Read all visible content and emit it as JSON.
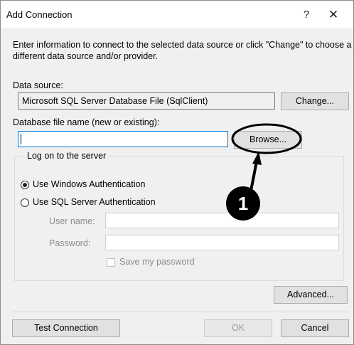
{
  "window": {
    "title": "Add Connection",
    "help_label": "?",
    "close_label": "✕"
  },
  "intro_text": "Enter information to connect to the selected data source or click \"Change\" to choose a different data source and/or provider.",
  "data_source": {
    "label": "Data source:",
    "value": "Microsoft SQL Server Database File (SqlClient)",
    "change_button": "Change..."
  },
  "database_file": {
    "label": "Database file name (new or existing):",
    "value": "",
    "browse_button": "Browse..."
  },
  "logon": {
    "group_label": "Log on to the server",
    "options": [
      {
        "label": "Use Windows Authentication",
        "selected": true
      },
      {
        "label": "Use SQL Server Authentication",
        "selected": false
      }
    ],
    "user_name_label": "User name:",
    "user_name_value": "",
    "password_label": "Password:",
    "password_value": "",
    "save_password_label": "Save my password",
    "save_password_checked": false
  },
  "buttons": {
    "advanced": "Advanced...",
    "test_connection": "Test Connection",
    "ok": "OK",
    "cancel": "Cancel"
  },
  "annotation": {
    "step_number": "1",
    "color": "#000000"
  }
}
